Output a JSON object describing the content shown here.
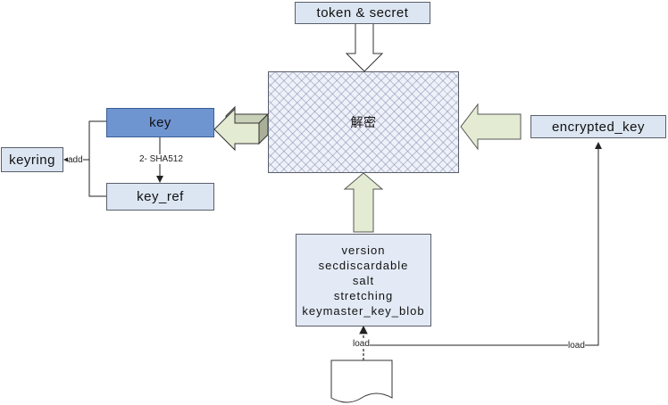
{
  "nodes": {
    "token_secret": "token & secret",
    "decrypt": "解密",
    "key": "key",
    "key_ref": "key_ref",
    "keyring": "keyring",
    "encrypted_key": "encrypted_key",
    "metadata_lines": [
      "version",
      "secdiscardable",
      "salt",
      "stretching",
      "keymaster_key_blob"
    ]
  },
  "edge_labels": {
    "sha512": "2- SHA512",
    "add": "add",
    "load_left": "load",
    "load_right": "load"
  },
  "colors": {
    "node_fill": "#dce6f2",
    "key_fill": "#6f95d1",
    "arrow_fill": "#e4ebd3",
    "hatch": "#8c96b4"
  }
}
